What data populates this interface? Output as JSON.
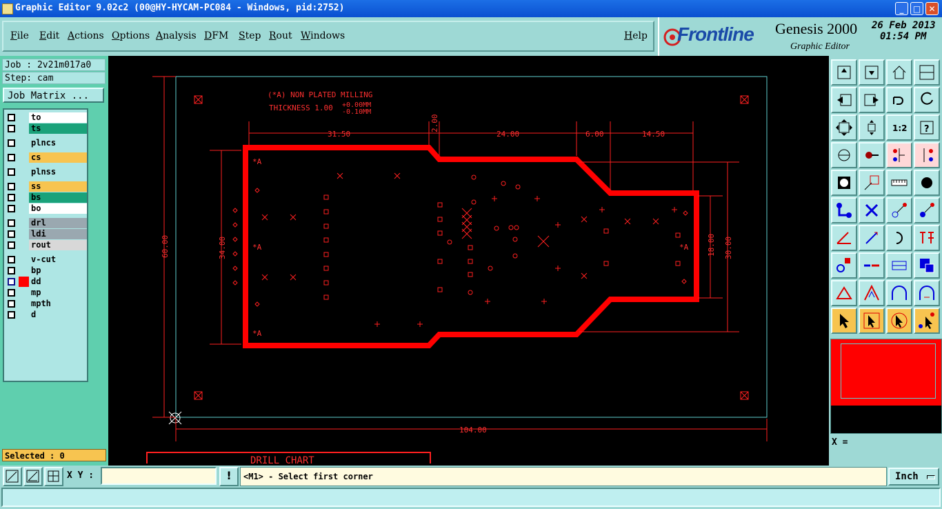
{
  "window": {
    "title": "Graphic Editor 9.02c2 (00@HY-HYCAM-PC084 - Windows, pid:2752)",
    "buttons": [
      "_",
      "□",
      "✕"
    ]
  },
  "menu": {
    "items": [
      "File",
      "Edit",
      "Actions",
      "Options",
      "Analysis",
      "DFM",
      "Step",
      "Rout",
      "Windows"
    ],
    "help": "Help"
  },
  "brand": {
    "logo": "Frontline",
    "product": "Genesis 2000",
    "subtitle": "Graphic Editor",
    "date": "26 Feb 2013",
    "time": "01:54 PM"
  },
  "job": {
    "job_label": "Job : 2v21m017a0",
    "step_label": "Step: cam",
    "matrix_button": "Job Matrix ..."
  },
  "layers": [
    {
      "name": "to",
      "color": "#ffffff"
    },
    {
      "name": "ts",
      "color": "#1aa27a"
    },
    {
      "name": "plncs",
      "color": "#aee6e4"
    },
    {
      "name": "cs",
      "color": "#f7c450"
    },
    {
      "name": "plnss",
      "color": "#aee6e4"
    },
    {
      "name": "ss",
      "color": "#f7c450"
    },
    {
      "name": "bs",
      "color": "#1aa27a"
    },
    {
      "name": "bo",
      "color": "#ffffff"
    },
    {
      "name": "drl",
      "color": "#9aa8b0"
    },
    {
      "name": "ldi",
      "color": "#9aa8b0"
    },
    {
      "name": "rout",
      "color": "#d8d8d8"
    },
    {
      "name": "v-cut",
      "color": "#aee6e4"
    },
    {
      "name": "bp",
      "color": "#aee6e4"
    },
    {
      "name": "dd",
      "color": "#aee6e4",
      "active": true
    },
    {
      "name": "mp",
      "color": "#aee6e4"
    },
    {
      "name": "mpth",
      "color": "#aee6e4"
    },
    {
      "name": "d",
      "color": "#aee6e4"
    }
  ],
  "selected": "Selected : 0",
  "drawing": {
    "note_line1": "(*A) NON PLATED MILLING",
    "note_line2": "THICKNESS 1.00",
    "tol_plus": "+0.00MM",
    "tol_minus": "-0.10MM",
    "dims": {
      "d1": "31.50",
      "d2": "2.00",
      "d3": "24.00",
      "d4": "6.00",
      "d5": "14.50",
      "height": "60.00",
      "inner": "34.00",
      "right1": "18.00",
      "right2": "30.00",
      "width": "104.00"
    },
    "mark": "*A",
    "chart_title": "DRILL CHART"
  },
  "coords": {
    "x_label": "X ="
  },
  "bottom": {
    "xy_label": "X Y :",
    "xy_value": "",
    "warn": "!",
    "prompt": "<M1> - Select first corner",
    "units": "Inch"
  },
  "colors": {
    "canvas": "#000000",
    "board": "#ff0000",
    "profile": "#5fd0d0",
    "accent_bg": "#9ed9d5"
  }
}
